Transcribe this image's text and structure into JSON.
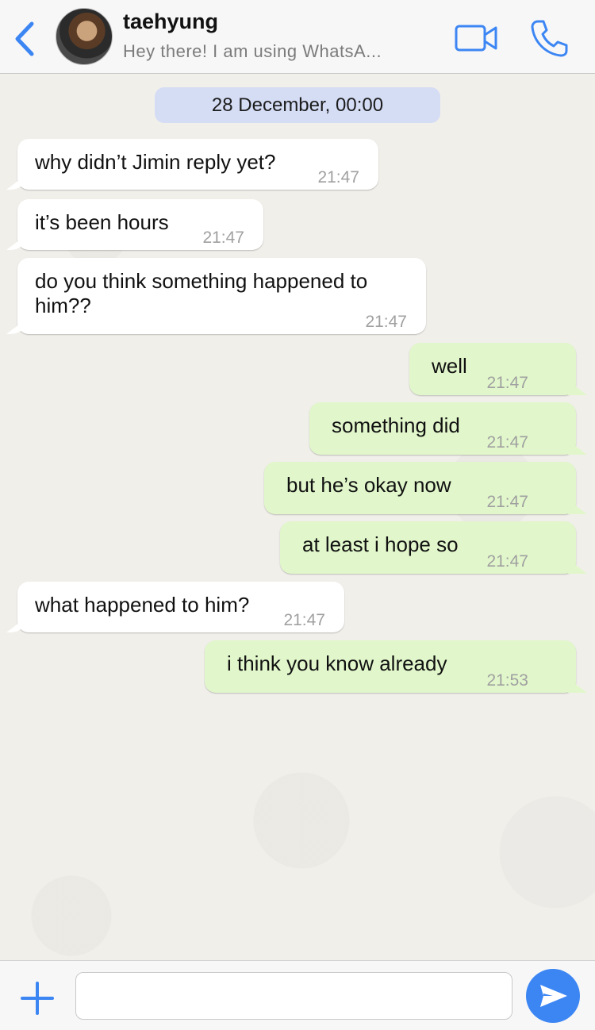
{
  "header": {
    "contact_name": "taehyung",
    "contact_status": "Hey there! I am using WhatsA...",
    "back_icon": "chevron-left-icon",
    "video_icon": "video-camera-icon",
    "call_icon": "phone-icon"
  },
  "chat": {
    "date_label": "28 December, 00:00",
    "messages": [
      {
        "direction": "in",
        "text": "why didn’t Jimin reply yet?",
        "time": "21:47"
      },
      {
        "direction": "in",
        "text": "it’s been hours",
        "time": "21:47"
      },
      {
        "direction": "in",
        "text_line1": "do you think something happened to",
        "text_line2": "him??",
        "time": "21:47"
      },
      {
        "direction": "out",
        "text": "well",
        "time": "21:47"
      },
      {
        "direction": "out",
        "text": "something did",
        "time": "21:47"
      },
      {
        "direction": "out",
        "text": "but he’s okay now",
        "time": "21:47"
      },
      {
        "direction": "out",
        "text": "at least i hope so",
        "time": "21:47"
      },
      {
        "direction": "in",
        "text": "what happened to him?",
        "time": "21:47"
      },
      {
        "direction": "out",
        "text": "i think you know already",
        "time": "21:53"
      }
    ]
  },
  "input": {
    "value": "",
    "plus_icon": "plus-icon",
    "send_icon": "send-arrow-icon"
  },
  "colors": {
    "accent": "#3c86f4",
    "incoming_bubble": "#ffffff",
    "outgoing_bubble": "#e1f7cb",
    "date_pill": "#d5ddf5",
    "chat_background": "#f1efea"
  }
}
